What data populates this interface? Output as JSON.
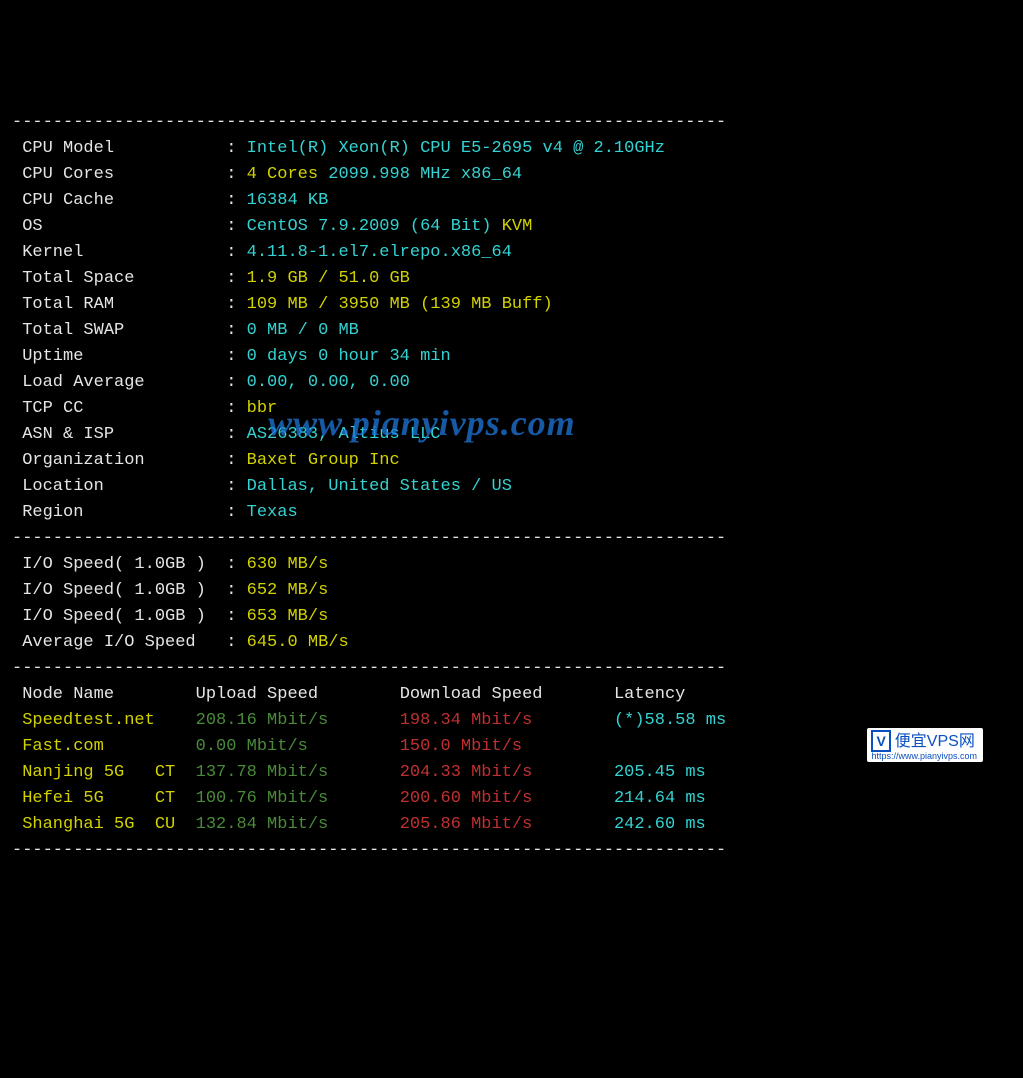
{
  "dash": "----------------------------------------------------------------------",
  "sysinfo": {
    "cpu_model": {
      "label": "CPU Model",
      "value": "Intel(R) Xeon(R) CPU E5-2695 v4 @ 2.10GHz"
    },
    "cpu_cores": {
      "label": "CPU Cores",
      "cores": "4 Cores",
      "freq": "2099.998 MHz x86_64"
    },
    "cpu_cache": {
      "label": "CPU Cache",
      "value": "16384 KB"
    },
    "os": {
      "label": "OS",
      "name": "CentOS 7.9.2009 (64 Bit)",
      "virt": "KVM"
    },
    "kernel": {
      "label": "Kernel",
      "value": "4.11.8-1.el7.elrepo.x86_64"
    },
    "total_space": {
      "label": "Total Space",
      "value": "1.9 GB / 51.0 GB"
    },
    "total_ram": {
      "label": "Total RAM",
      "value": "109 MB / 3950 MB (139 MB Buff)"
    },
    "total_swap": {
      "label": "Total SWAP",
      "value": "0 MB / 0 MB"
    },
    "uptime": {
      "label": "Uptime",
      "value": "0 days 0 hour 34 min"
    },
    "load_avg": {
      "label": "Load Average",
      "value": "0.00, 0.00, 0.00"
    },
    "tcp_cc": {
      "label": "TCP CC",
      "value": "bbr"
    },
    "asn_isp": {
      "label": "ASN & ISP",
      "value": "AS26383, Altius LLC"
    },
    "org": {
      "label": "Organization",
      "value": "Baxet Group Inc"
    },
    "location": {
      "label": "Location",
      "value": "Dallas, United States / US"
    },
    "region": {
      "label": "Region",
      "value": "Texas"
    }
  },
  "io": {
    "label": "I/O Speed( 1.0GB )",
    "run1": "630 MB/s",
    "run2": "652 MB/s",
    "run3": "653 MB/s",
    "avg_label": "Average I/O Speed",
    "avg": "645.0 MB/s"
  },
  "speed_header": {
    "node": "Node Name",
    "up": "Upload Speed",
    "down": "Download Speed",
    "lat": "Latency"
  },
  "speedtests": [
    {
      "node": "Speedtest.net",
      "tag": "",
      "up": "208.16 Mbit/s",
      "down": "198.34 Mbit/s",
      "lat": "(*)58.58 ms"
    },
    {
      "node": "Fast.com",
      "tag": "",
      "up": "0.00 Mbit/s",
      "down": "150.0 Mbit/s",
      "lat": ""
    },
    {
      "node": "Nanjing 5G",
      "tag": "CT",
      "up": "137.78 Mbit/s",
      "down": "204.33 Mbit/s",
      "lat": "205.45 ms"
    },
    {
      "node": "Hefei 5G",
      "tag": "CT",
      "up": "100.76 Mbit/s",
      "down": "200.60 Mbit/s",
      "lat": "214.64 ms"
    },
    {
      "node": "Shanghai 5G",
      "tag": "CU",
      "up": "132.84 Mbit/s",
      "down": "205.86 Mbit/s",
      "lat": "242.60 ms"
    }
  ],
  "watermark": {
    "main": "www.pianyivps.com",
    "badge": "V",
    "text": "便宜VPS网",
    "url": "https://www.pianyivps.com"
  }
}
